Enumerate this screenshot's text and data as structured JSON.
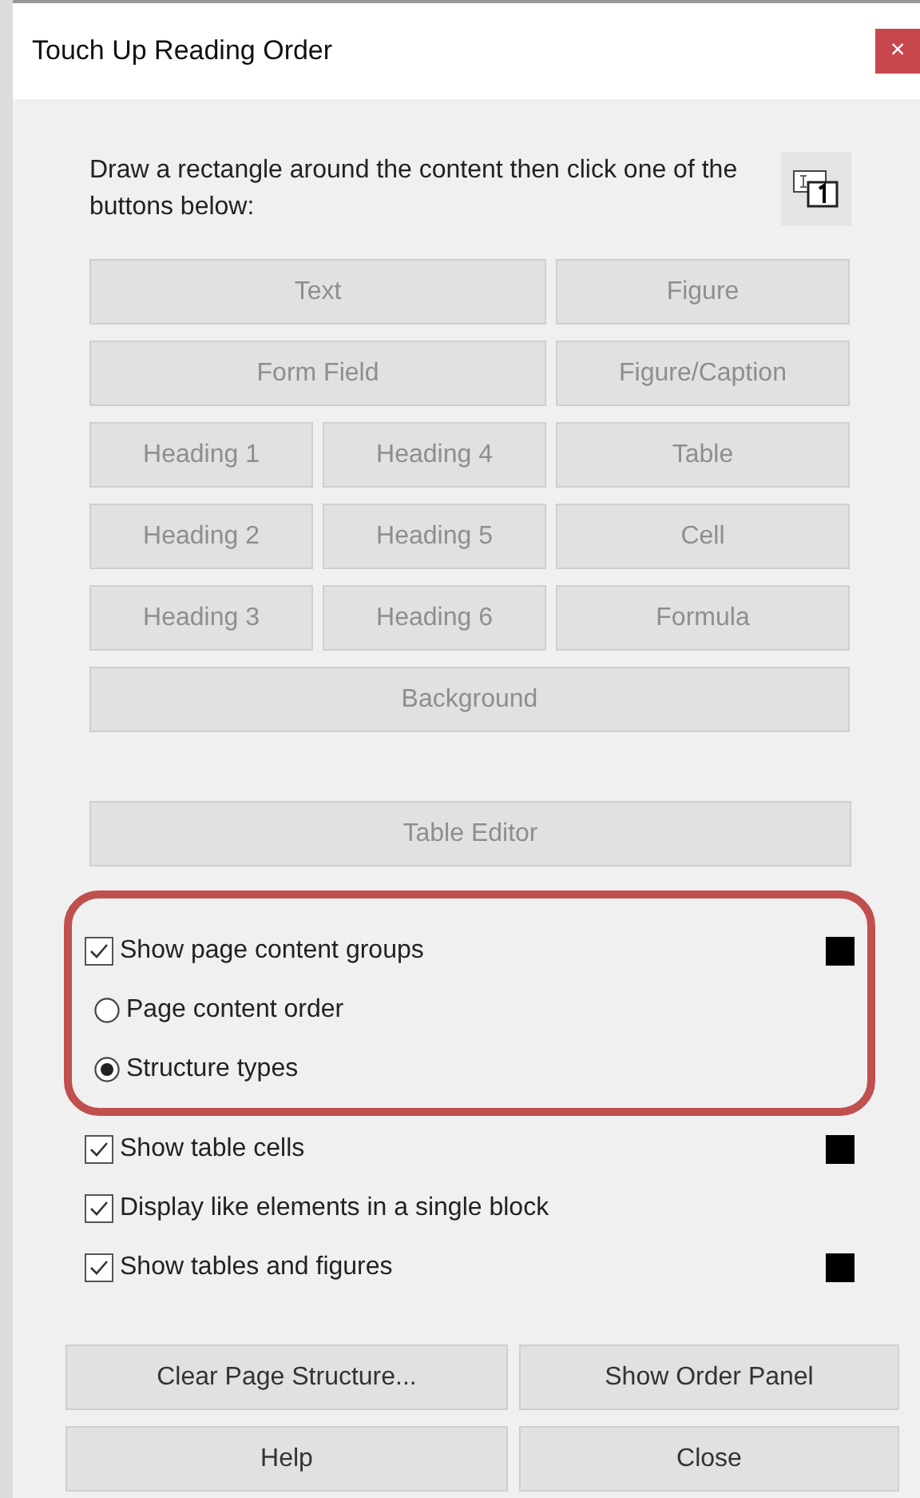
{
  "window": {
    "title": "Touch Up Reading Order",
    "close": "×"
  },
  "instructions": "Draw a rectangle around the content then click one of the buttons below:",
  "tag_rows": [
    [
      {
        "label": "Text",
        "disabled": true
      },
      {
        "label": "Figure",
        "disabled": true
      }
    ],
    [
      {
        "label": "Form Field",
        "disabled": true
      },
      {
        "label": "Figure/Caption",
        "disabled": true
      }
    ],
    [
      {
        "label": "Heading 1",
        "disabled": true
      },
      {
        "label": "Heading 4",
        "disabled": true
      },
      {
        "label": "Table",
        "disabled": true
      }
    ],
    [
      {
        "label": "Heading 2",
        "disabled": true
      },
      {
        "label": "Heading 5",
        "disabled": true
      },
      {
        "label": "Cell",
        "disabled": true
      }
    ],
    [
      {
        "label": "Heading 3",
        "disabled": true
      },
      {
        "label": "Heading 6",
        "disabled": true
      },
      {
        "label": "Formula",
        "disabled": true
      }
    ],
    [
      {
        "label": "Background",
        "disabled": true
      }
    ]
  ],
  "table_editor": {
    "label": "Table Editor",
    "disabled": true
  },
  "options": [
    {
      "kind": "checkbox",
      "label": "Show page content groups",
      "checked": true,
      "color": "#000000",
      "highlighted": true
    },
    {
      "kind": "radio",
      "label": "Page content order",
      "selected": false,
      "highlighted": true
    },
    {
      "kind": "radio",
      "label": "Structure types",
      "selected": true,
      "highlighted": true
    },
    {
      "kind": "checkbox",
      "label": "Show table cells",
      "checked": true,
      "color": "#000000",
      "highlighted": false
    },
    {
      "kind": "checkbox",
      "label": "Display like elements in a single block",
      "checked": true,
      "highlighted": false
    },
    {
      "kind": "checkbox",
      "label": "Show tables and figures",
      "checked": true,
      "color": "#000000",
      "highlighted": false
    }
  ],
  "footer_buttons": [
    "Clear Page Structure...",
    "Show Order Panel",
    "Help",
    "Close"
  ]
}
